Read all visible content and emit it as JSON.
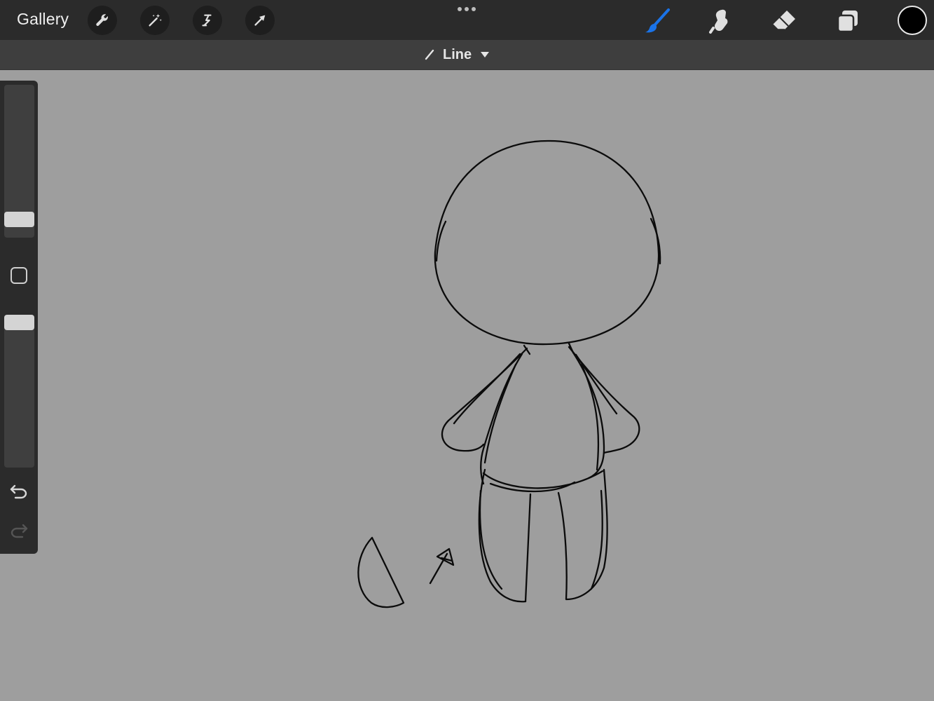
{
  "toolbar": {
    "gallery_label": "Gallery",
    "left_tools": [
      "wrench-icon",
      "magic-wand-icon",
      "selection-icon",
      "transform-arrow-icon"
    ],
    "right_tools": [
      "brush-icon",
      "smudge-icon",
      "eraser-icon",
      "layers-icon"
    ],
    "active_tool": "brush-icon",
    "accent_color": "#1a73e8",
    "current_color": "#000000"
  },
  "shape_bar": {
    "label": "Line"
  },
  "sidebar": {
    "brush_size_level": 0.12,
    "opacity_level": 1.0
  },
  "colors": {
    "canvas_bg": "#9e9e9e",
    "toolbar_bg": "#2b2b2b",
    "subbar_bg": "#3e3e3e"
  }
}
